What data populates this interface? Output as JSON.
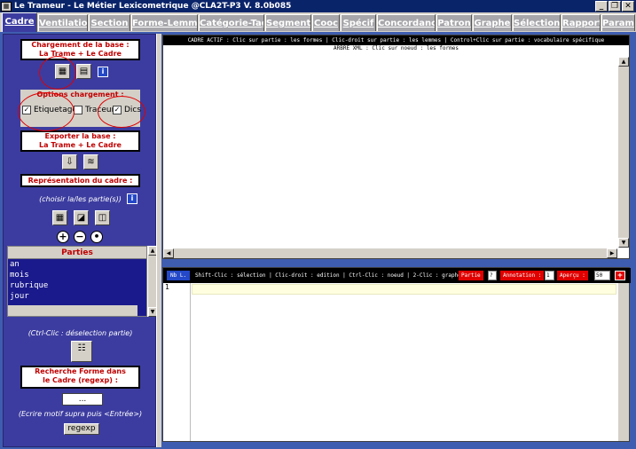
{
  "window": {
    "title": "Le Trameur - Le Métier Lexicometrique @CLA2T-P3 V. 8.0b085",
    "controls": [
      "_",
      "❐",
      "✕"
    ]
  },
  "tabs": [
    "Cadre",
    "Ventilation",
    "Section",
    "Forme-Lemme",
    "Catégorie-Tag",
    "Segment",
    "Cooc",
    "Spécif",
    "Concordance",
    "Patron",
    "Graphe",
    "Sélection",
    "Rapport",
    "Param"
  ],
  "active_tab": "Cadre",
  "left": {
    "load_title_1": "Chargement de la base :",
    "load_title_2": "La Trame + Le Cadre",
    "options_title": "Options chargement :",
    "opt_etiquetage": "Etiquetage",
    "opt_traceur": "Traceur",
    "opt_dics": "Dics",
    "export_title_1": "Exporter la base :",
    "export_title_2": "La Trame + Le Cadre",
    "repr_title": "Représentation du cadre :",
    "choose_parts": "(choisir la/les partie(s))",
    "parts_header": "Parties",
    "parts": [
      "an",
      "mois",
      "rubrique",
      "jour"
    ],
    "deselect_note": "(Ctrl-Clic : déselection partie)",
    "search_title_1": "Recherche Forme dans",
    "search_title_2": "le Cadre (regexp) :",
    "search_value": "...",
    "search_hint": "(Ecrire motif supra puis <Entrée>)",
    "regexp_button": "regexp"
  },
  "tree_panel": {
    "header": "CADRE ACTIF : Clic sur partie : les formes | Clic-droit sur partie : les lemmes | Control+Clic sur partie : vocabulaire spécifique",
    "subheader": "ARBRE XML : Clic sur noeud : les formes"
  },
  "edit_panel": {
    "nb_label": "Nb L.",
    "instructions": "Shift-Clic : sélection | Clic-droit : edition | Ctrl-Clic : noeud | 2-Clic : graphe",
    "partie_label": "Partie",
    "partie_value": "?",
    "annotation_label": "Annotation :",
    "annotation_value": "1",
    "apercu_label": "Aperçu :",
    "apercu_value": "50",
    "close_icon": "+",
    "line_number": "1"
  },
  "colors": {
    "frame": "#3f5db0",
    "panel": "#3c3ca0",
    "accent_red": "#c00000",
    "tab_inactive": "#a7a6aa"
  }
}
